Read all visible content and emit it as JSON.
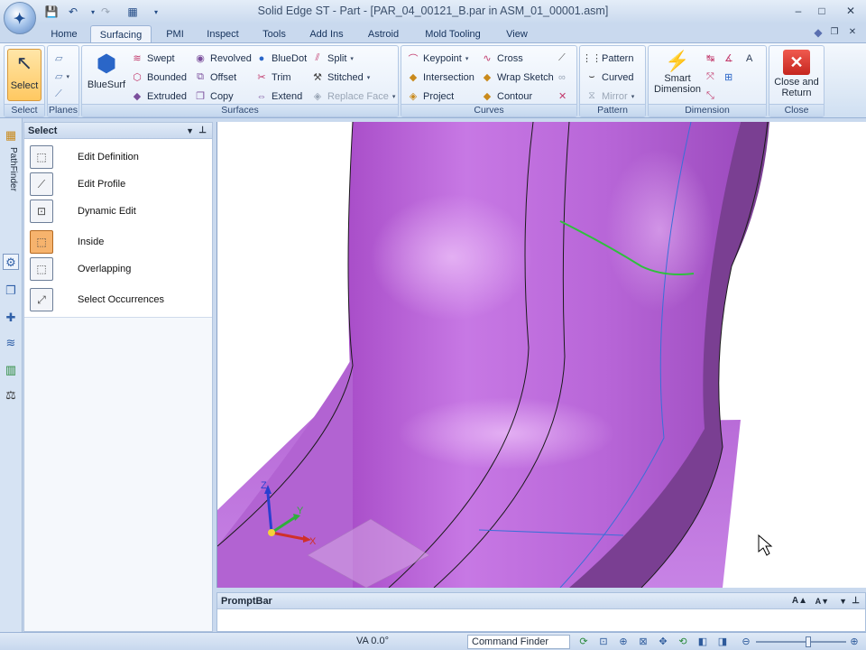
{
  "window": {
    "title": "Solid Edge ST - Part - [PAR_04_00121_B.par in ASM_01_00001.asm]",
    "minimize": "–",
    "maximize": "□",
    "close": "✕",
    "doc_restore": "❐",
    "doc_close": "✕"
  },
  "ribbon_tabs": [
    "Home",
    "Surfacing",
    "PMI",
    "Inspect",
    "Tools",
    "Add Ins",
    "Astroid",
    "Mold Tooling",
    "View"
  ],
  "active_tab": "Surfacing",
  "groups": {
    "select": {
      "label": "Select",
      "button": "Select"
    },
    "planes": {
      "label": "Planes"
    },
    "surfaces": {
      "label": "Surfaces",
      "bluesurf": "BlueSurf",
      "items": [
        "Swept",
        "Bounded",
        "Extruded",
        "Revolved",
        "Offset",
        "Copy",
        "BlueDot",
        "Trim",
        "Extend",
        "Split",
        "Stitched",
        "Replace Face"
      ]
    },
    "curves": {
      "label": "Curves",
      "items": [
        "Keypoint",
        "Intersection",
        "Project",
        "Cross",
        "Wrap Sketch",
        "Contour"
      ]
    },
    "pattern": {
      "label": "Pattern",
      "items": [
        "Pattern",
        "Curved",
        "Mirror"
      ]
    },
    "dimension": {
      "label": "Dimension",
      "smart_dimension": "Smart Dimension"
    },
    "close": {
      "label": "Close",
      "button": "Close and Return"
    }
  },
  "left_strip": {
    "pathfinder": "PathFinder"
  },
  "select_panel": {
    "title": "Select",
    "items": [
      {
        "label": "Edit Definition",
        "active": false
      },
      {
        "label": "Edit Profile",
        "active": false
      },
      {
        "label": "Dynamic Edit",
        "active": false
      },
      {
        "label": "Inside",
        "active": true
      },
      {
        "label": "Overlapping",
        "active": false
      },
      {
        "label": "Select Occurrences",
        "active": false
      }
    ]
  },
  "triad": {
    "x": "X",
    "y": "Y",
    "z": "Z"
  },
  "promptbar": {
    "title": "PromptBar"
  },
  "statusbar": {
    "view_angle": "VA 0.0°",
    "command_finder": "Command Finder"
  },
  "colors": {
    "part_face": "#b86ad8",
    "part_side": "#7a3f92",
    "edge_highlight": "#2fbf3d",
    "edge_blue": "#3a6fd8",
    "close_button": "#d9312b"
  }
}
